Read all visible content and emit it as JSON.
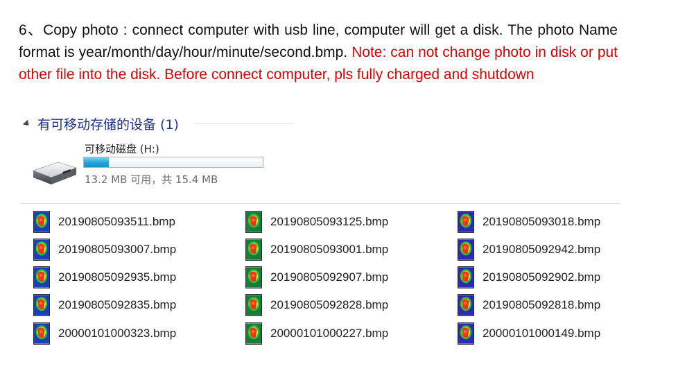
{
  "instructions": {
    "main_text": "6、Copy photo : connect computer with usb line, computer will get a disk. The photo Name format is year/month/day/hour/minute/second.bmp. ",
    "note_text": "Note: can not change photo in disk or put other file into the disk. Before connect computer, pls fully charged and shutdown"
  },
  "explorer": {
    "group_title": "有可移动存储的设备 (1)",
    "drive": {
      "name": "可移动磁盘 (H:)",
      "space_text": "13.2 MB 可用，共 15.4 MB",
      "used_fraction": 0.14,
      "icon": "removable-drive-icon"
    }
  },
  "files": [
    {
      "name": "20190805093511.bmp",
      "icon": "thermal-image-icon"
    },
    {
      "name": "20190805093125.bmp",
      "icon": "thermal-image-icon"
    },
    {
      "name": "20190805093018.bmp",
      "icon": "thermal-image-icon"
    },
    {
      "name": "20190805093007.bmp",
      "icon": "thermal-image-icon"
    },
    {
      "name": "20190805093001.bmp",
      "icon": "thermal-image-icon"
    },
    {
      "name": "20190805092942.bmp",
      "icon": "thermal-image-icon"
    },
    {
      "name": "20190805092935.bmp",
      "icon": "thermal-image-icon"
    },
    {
      "name": "20190805092907.bmp",
      "icon": "thermal-image-icon"
    },
    {
      "name": "20190805092902.bmp",
      "icon": "thermal-image-icon"
    },
    {
      "name": "20190805092835.bmp",
      "icon": "thermal-image-icon"
    },
    {
      "name": "20190805092828.bmp",
      "icon": "thermal-image-icon"
    },
    {
      "name": "20190805092818.bmp",
      "icon": "thermal-image-icon"
    },
    {
      "name": "20000101000323.bmp",
      "icon": "thermal-image-icon"
    },
    {
      "name": "20000101000227.bmp",
      "icon": "thermal-image-icon"
    },
    {
      "name": "20000101000149.bmp",
      "icon": "thermal-image-icon"
    }
  ]
}
